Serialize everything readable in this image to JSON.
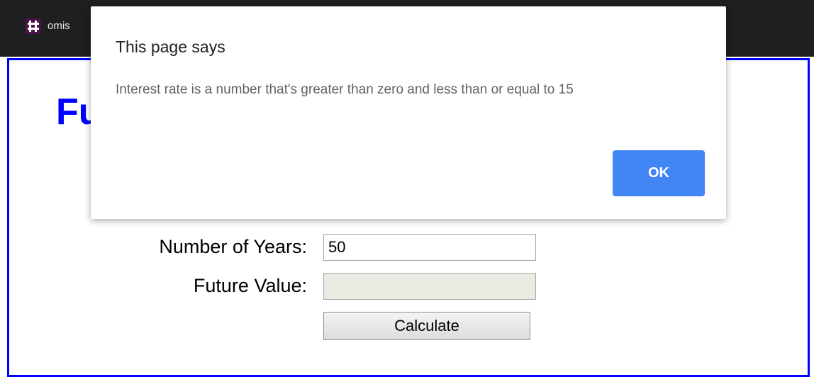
{
  "browser": {
    "tab_title": "omis",
    "tab_icon": "slack-icon"
  },
  "page": {
    "title": "Fu",
    "fields": {
      "years": {
        "label": "Number of Years:",
        "value": "50"
      },
      "future_value": {
        "label": "Future Value:",
        "value": ""
      }
    },
    "calculate_label": "Calculate"
  },
  "dialog": {
    "title": "This page says",
    "message": "Interest rate is a number that's greater than zero and less than or equal to 15",
    "ok_label": "OK"
  },
  "colors": {
    "accent_blue": "#0000ff",
    "dialog_button": "#4285f4"
  }
}
